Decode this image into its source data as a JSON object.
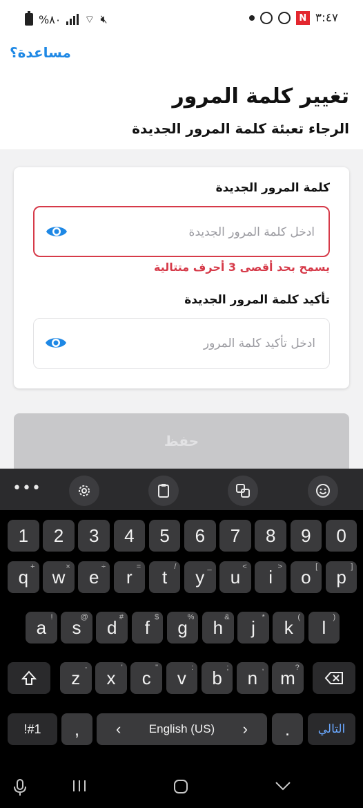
{
  "status": {
    "battery": "%٨٠",
    "time": "٣:٤٧",
    "app_badge": "N"
  },
  "header": {
    "help": "مساعدة؟",
    "title": "تغيير كلمة المرور",
    "subtitle": "الرجاء تعبئة كلمة المرور الجديدة"
  },
  "form": {
    "new_password_label": "كلمة المرور الجديدة",
    "new_password_placeholder": "ادخل كلمة المرور الجديدة",
    "new_password_value": "",
    "error_message": "يسمح بحد أقصى 3 أحرف متتالية",
    "confirm_label": "تأكيد كلمة المرور الجديدة",
    "confirm_placeholder": "ادخل تأكيد كلمة المرور",
    "confirm_value": "",
    "save_label": "حفظ"
  },
  "colors": {
    "accent": "#1e88e5",
    "error": "#d63a49",
    "disabled_button": "#c8c8ca"
  },
  "keyboard": {
    "toolbar": [
      "more-icon",
      "gear-icon",
      "clipboard-icon",
      "translate-icon",
      "emoji-icon"
    ],
    "number_row": [
      "1",
      "2",
      "3",
      "4",
      "5",
      "6",
      "7",
      "8",
      "9",
      "0"
    ],
    "row1": [
      {
        "k": "q",
        "s": "+"
      },
      {
        "k": "w",
        "s": "×"
      },
      {
        "k": "e",
        "s": "÷"
      },
      {
        "k": "r",
        "s": "="
      },
      {
        "k": "t",
        "s": "/"
      },
      {
        "k": "y",
        "s": "_"
      },
      {
        "k": "u",
        "s": "<"
      },
      {
        "k": "i",
        "s": ">"
      },
      {
        "k": "o",
        "s": "["
      },
      {
        "k": "p",
        "s": "]"
      }
    ],
    "row2": [
      {
        "k": "a",
        "s": "!"
      },
      {
        "k": "s",
        "s": "@"
      },
      {
        "k": "d",
        "s": "#"
      },
      {
        "k": "f",
        "s": "$"
      },
      {
        "k": "g",
        "s": "%"
      },
      {
        "k": "h",
        "s": "&"
      },
      {
        "k": "j",
        "s": "*"
      },
      {
        "k": "k",
        "s": "("
      },
      {
        "k": "l",
        "s": ")"
      }
    ],
    "row3": [
      {
        "k": "z",
        "s": "-"
      },
      {
        "k": "x",
        "s": "'"
      },
      {
        "k": "c",
        "s": "\""
      },
      {
        "k": "v",
        "s": ":"
      },
      {
        "k": "b",
        "s": ";"
      },
      {
        "k": "n",
        "s": ","
      },
      {
        "k": "m",
        "s": "?"
      }
    ],
    "symbols_key": "!#1",
    "comma_key": ",",
    "space_label": "English (US)",
    "period_key": ".",
    "next_key": "التالي"
  }
}
